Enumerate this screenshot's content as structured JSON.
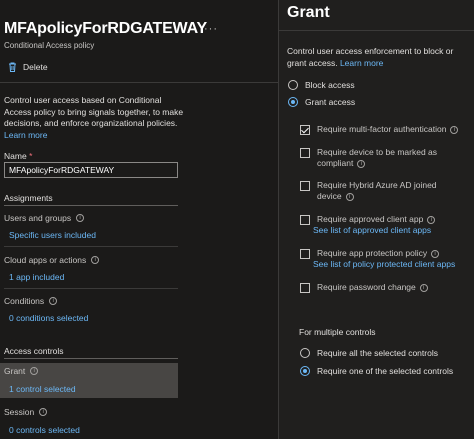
{
  "left": {
    "title": "MFApolicyForRDGATEWAY",
    "more": "···",
    "subtitle": "Conditional Access policy",
    "delete_label": "Delete",
    "description": "Control user access based on Conditional Access policy to bring signals together, to make decisions, and enforce organizational policies.",
    "learn_more": "Learn more",
    "name_label": "Name",
    "name_required": "*",
    "name_value": "MFApolicyForRDGATEWAY",
    "assignments_heading": "Assignments",
    "users_label": "Users and groups",
    "users_value": "Specific users included",
    "apps_label": "Cloud apps or actions",
    "apps_value": "1 app included",
    "conditions_label": "Conditions",
    "conditions_value": "0 conditions selected",
    "access_heading": "Access controls",
    "grant_label": "Grant",
    "grant_value": "1 control selected",
    "session_label": "Session",
    "session_value": "0 controls selected"
  },
  "grant": {
    "title": "Grant",
    "description": "Control user access enforcement to block or grant access.",
    "learn_more": "Learn more",
    "block_label": "Block access",
    "grant_label": "Grant access",
    "selected_mode": "grant",
    "controls": [
      {
        "label": "Require multi-factor authentication",
        "checked": true
      },
      {
        "label": "Require device to be marked as compliant",
        "checked": false
      },
      {
        "label": "Require Hybrid Azure AD joined device",
        "checked": false
      },
      {
        "label": "Require approved client app",
        "link": "See list of approved client apps",
        "checked": false
      },
      {
        "label": "Require app protection policy",
        "link": "See list of policy protected client apps",
        "checked": false
      },
      {
        "label": "Require password change",
        "checked": false
      }
    ],
    "multiple_heading": "For multiple controls",
    "require_all": "Require all the selected controls",
    "require_one": "Require one of the selected controls",
    "multiple_mode": "one"
  },
  "colors": {
    "background": "#1b1a19",
    "panel": "#201f1e",
    "link": "#6cb8f6",
    "selected_row": "#484644",
    "required": "#f1707b"
  }
}
